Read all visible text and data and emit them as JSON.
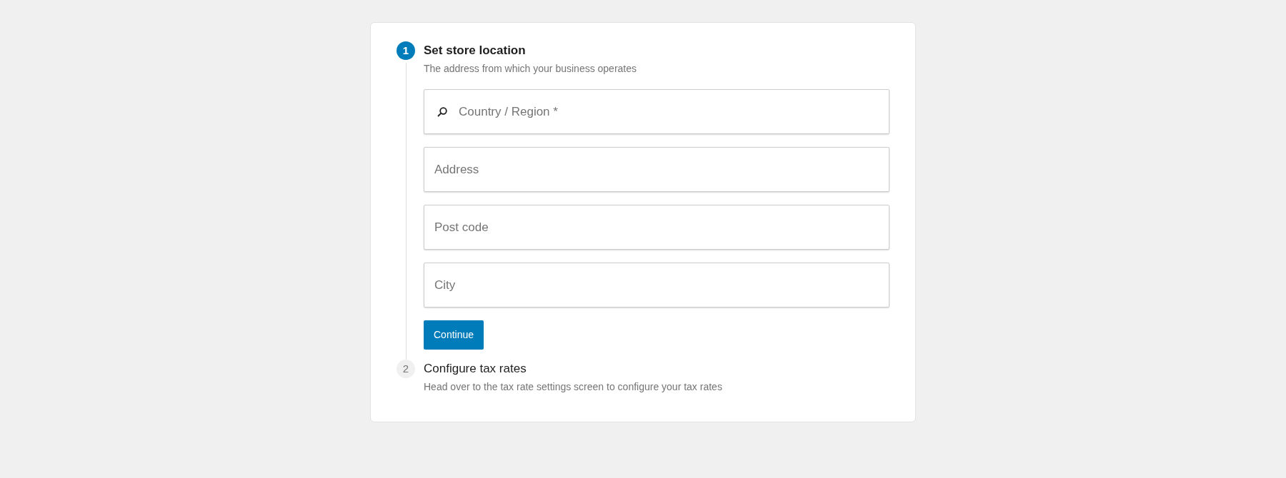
{
  "steps": [
    {
      "number": "1",
      "title": "Set store location",
      "description": "The address from which your business operates",
      "selected": true,
      "fields": [
        {
          "kind": "search",
          "placeholder": "Country / Region *"
        },
        {
          "kind": "text",
          "placeholder": "Address"
        },
        {
          "kind": "text",
          "placeholder": "Post code"
        },
        {
          "kind": "text",
          "placeholder": "City"
        }
      ],
      "button": "Continue"
    },
    {
      "number": "2",
      "title": "Configure tax rates",
      "description": "Head over to the tax rate settings screen to configure your tax rates",
      "selected": false
    }
  ]
}
